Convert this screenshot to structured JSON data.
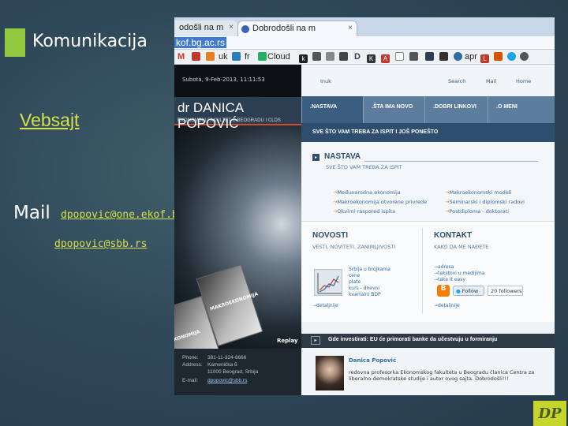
{
  "slide": {
    "title": "Komunikacija",
    "website_link": "Vebsajt",
    "mail_label": "Mail",
    "emails": [
      "dpopovic@one.ekof.bg.ac.rs",
      "dpopovic@sbb.rs"
    ],
    "logo_text": "DP",
    "colors": {
      "accent": "#92c83e",
      "link": "#d6e04a",
      "logo_bg": "#c7d62c"
    }
  },
  "browser": {
    "tabs": [
      {
        "label": "odošli na m",
        "close": "×"
      },
      {
        "label": "Dobrodošli na m",
        "close": "×"
      }
    ],
    "url": "kof.bg.ac.rs",
    "bookmarks": [
      {
        "icon": "gmail-icon",
        "label": "M"
      },
      {
        "icon": "square-icon",
        "label": "uk"
      },
      {
        "icon": "square-icon",
        "label": "fr"
      },
      {
        "icon": "cloud-icon",
        "label": "Cloud"
      },
      {
        "icon": "k-icon",
        "label": "k"
      },
      {
        "icon": "d-icon",
        "label": "D"
      },
      {
        "icon": "k-icon",
        "label": "K"
      },
      {
        "icon": "a-icon",
        "label": "A"
      },
      {
        "icon": "apr-icon",
        "label": "apr"
      },
      {
        "icon": "l-icon",
        "label": "L"
      }
    ]
  },
  "page": {
    "date": "Subota, 9-Feb-2013, 11:11:53",
    "header_name": "dr DANICA POPOVIĆ",
    "header_sub": "EKONOMSKI FAKULTET U BEOGRADU I CLDS",
    "top_links": {
      "lang": "Inuk",
      "search": "Search",
      "mail": "Mail",
      "home": "Home"
    },
    "nav": [
      ".NASTAVA",
      ".ŠTA IMA NOVO",
      ".DOBRI LINKOVI",
      ".O MENI"
    ],
    "subbanner": "SVE ŠTO VAM TREBA ZA ISPIT I JOŠ PONEŠTO",
    "section_title": "NASTAVA",
    "section_sub": "SVE ŠTO VAM TREBA ZA ISPIT",
    "links_left": [
      "Međunarodna ekonomija",
      "Makroekonomija otvorene privrede",
      "Okvirni raspored ispita"
    ],
    "links_right": [
      "Makroekonomski modeli",
      "Seminarski i diplomski radovi",
      "Postdiploma - doktorati"
    ],
    "news": {
      "title": "NOVOSTI",
      "sub": "VESTI, NOVITETI, ZANIMLJIVOSTI",
      "items": [
        "Srbija u brojkama",
        "cene",
        "plate",
        "kurs - dnevni",
        "kvartalni BDP"
      ],
      "detail": "detaljnije"
    },
    "contact": {
      "title": "KONTAKT",
      "sub": "KAKO DA ME NAĐETE",
      "items": [
        "adresa",
        "tekstovi u medijima",
        "take it easy"
      ],
      "follow": "Follow",
      "followers": "20 followers",
      "detail": "detaljnije"
    },
    "book_label": "MAKROEKONOMIJA",
    "book_label_2": "EKONOMIJA",
    "replay": "Replay",
    "ticker": "Gde investirati: EU će primorati banke da učestvuju u formiranju",
    "contact_block": {
      "phone_label": "Phone:",
      "phone": "381-11-324-6666",
      "address_label": "Address:",
      "address1": "Kamenička 6",
      "address2": "11000 Beograd, Srbija",
      "email_label": "E-mail:",
      "email": "dpopovic@sbb.rs"
    },
    "profile": {
      "name": "Danica Popović",
      "desc": "redovna profesorka Ekonomskog fakulteta u Beogradu članica Centra za liberalno-demokratske studije i autor ovog sajta. Dobrodošli!!!"
    }
  }
}
